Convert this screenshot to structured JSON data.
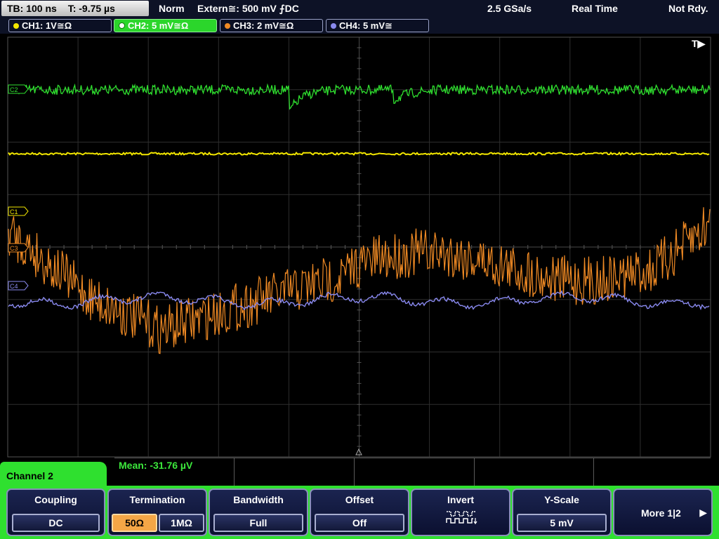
{
  "status": {
    "timebase": "TB: 100 ns",
    "trigger_time": "T: -9.75 µs",
    "acq_mode": "Norm",
    "trigger_info": "Extern≅: 500 mV ⨍DC",
    "sample_rate": "2.5 GSa/s",
    "acq_type": "Real Time",
    "run_state": "Not Rdy."
  },
  "channels": [
    {
      "label": "CH1: 1V≅Ω",
      "color": "#f2e600"
    },
    {
      "label": "CH2: 5 mV≅Ω",
      "color": "#2fe02f"
    },
    {
      "label": "CH3: 2 mV≅Ω",
      "color": "#f08a24"
    },
    {
      "label": "CH4: 5 mV≅",
      "color": "#8a8af0"
    }
  ],
  "markers": {
    "c1": "C1",
    "c2": "C2",
    "c3": "C3",
    "c4": "C4",
    "trigger": "T▶"
  },
  "measurement": {
    "mean": "Mean: -31.76 µV"
  },
  "menu": {
    "tab": "Channel 2",
    "coupling": {
      "title": "Coupling",
      "value": "DC"
    },
    "termination": {
      "title": "Termination",
      "opt1": "50Ω",
      "opt2": "1MΩ"
    },
    "bandwidth": {
      "title": "Bandwidth",
      "value": "Full"
    },
    "offset": {
      "title": "Offset",
      "value": "Off"
    },
    "invert": {
      "title": "Invert",
      "icon": "invert-waveform-icon"
    },
    "yscale": {
      "title": "Y-Scale",
      "value": "5 mV"
    },
    "more": {
      "label": "More 1|2"
    }
  }
}
